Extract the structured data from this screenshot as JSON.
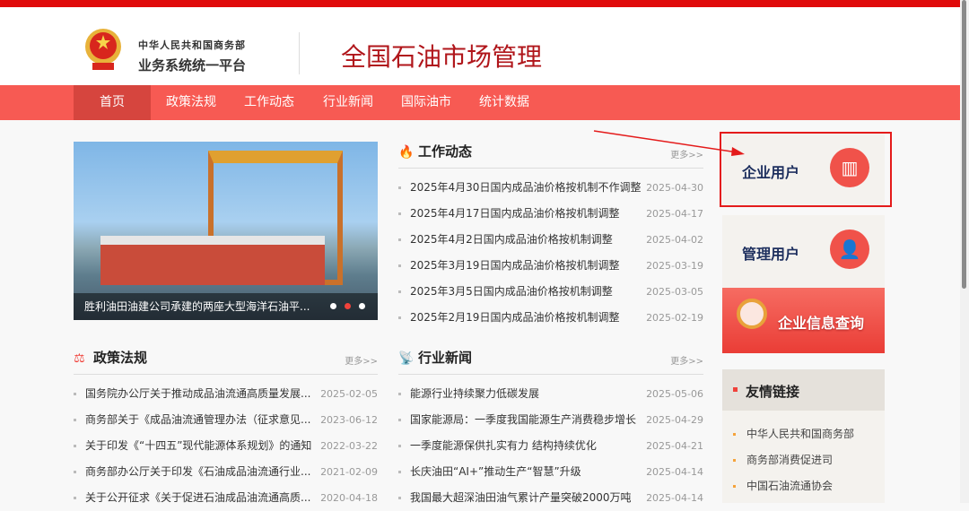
{
  "header": {
    "org_line1": "中华人民共和国商务部",
    "org_line2": "业务系统统一平台",
    "title": "全国石油市场管理"
  },
  "nav": [
    {
      "label": "首页",
      "active": true
    },
    {
      "label": "政策法规"
    },
    {
      "label": "工作动态"
    },
    {
      "label": "行业新闻"
    },
    {
      "label": "国际油市"
    },
    {
      "label": "统计数据"
    }
  ],
  "carousel": {
    "caption": "胜利油田油建公司承建的两座大型海洋石油平...",
    "slides": 3,
    "active_slide": 2
  },
  "work": {
    "title": "工作动态",
    "more": "更多>>",
    "items": [
      {
        "text": "2025年4月30日国内成品油价格按机制不作调整",
        "date": "2025-04-30"
      },
      {
        "text": "2025年4月17日国内成品油价格按机制调整",
        "date": "2025-04-17"
      },
      {
        "text": "2025年4月2日国内成品油价格按机制调整",
        "date": "2025-04-02"
      },
      {
        "text": "2025年3月19日国内成品油价格按机制调整",
        "date": "2025-03-19"
      },
      {
        "text": "2025年3月5日国内成品油价格按机制调整",
        "date": "2025-03-05"
      },
      {
        "text": "2025年2月19日国内成品油价格按机制调整",
        "date": "2025-02-19"
      }
    ]
  },
  "policy": {
    "title": "政策法规",
    "more": "更多>>",
    "items": [
      {
        "text": "国务院办公厅关于推动成品油流通高质量发展...",
        "date": "2025-02-05"
      },
      {
        "text": "商务部关于《成品油流通管理办法（征求意见...",
        "date": "2023-06-12"
      },
      {
        "text": "关于印发《“十四五”现代能源体系规划》的通知",
        "date": "2022-03-22"
      },
      {
        "text": "商务部办公厅关于印发《石油成品油流通行业...",
        "date": "2021-02-09"
      },
      {
        "text": "关于公开征求《关于促进石油成品油流通高质...",
        "date": "2020-04-18"
      }
    ]
  },
  "industry": {
    "title": "行业新闻",
    "more": "更多>>",
    "items": [
      {
        "text": "能源行业持续聚力低碳发展",
        "date": "2025-05-06"
      },
      {
        "text": "国家能源局：一季度我国能源生产消费稳步增长",
        "date": "2025-04-29"
      },
      {
        "text": "一季度能源保供扎实有力 结构持续优化",
        "date": "2025-04-21"
      },
      {
        "text": "长庆油田“AI+”推动生产“智慧”升级",
        "date": "2025-04-14"
      },
      {
        "text": "我国最大超深油田油气累计产量突破2000万吨",
        "date": "2025-04-14"
      }
    ]
  },
  "sidebar": {
    "enterprise_user": "企业用户",
    "admin_user": "管理用户",
    "query_banner": "企业信息查询",
    "links_title": "友情链接",
    "links": [
      "中华人民共和国商务部",
      "商务部消费促进司",
      "中国石油流通协会"
    ]
  }
}
